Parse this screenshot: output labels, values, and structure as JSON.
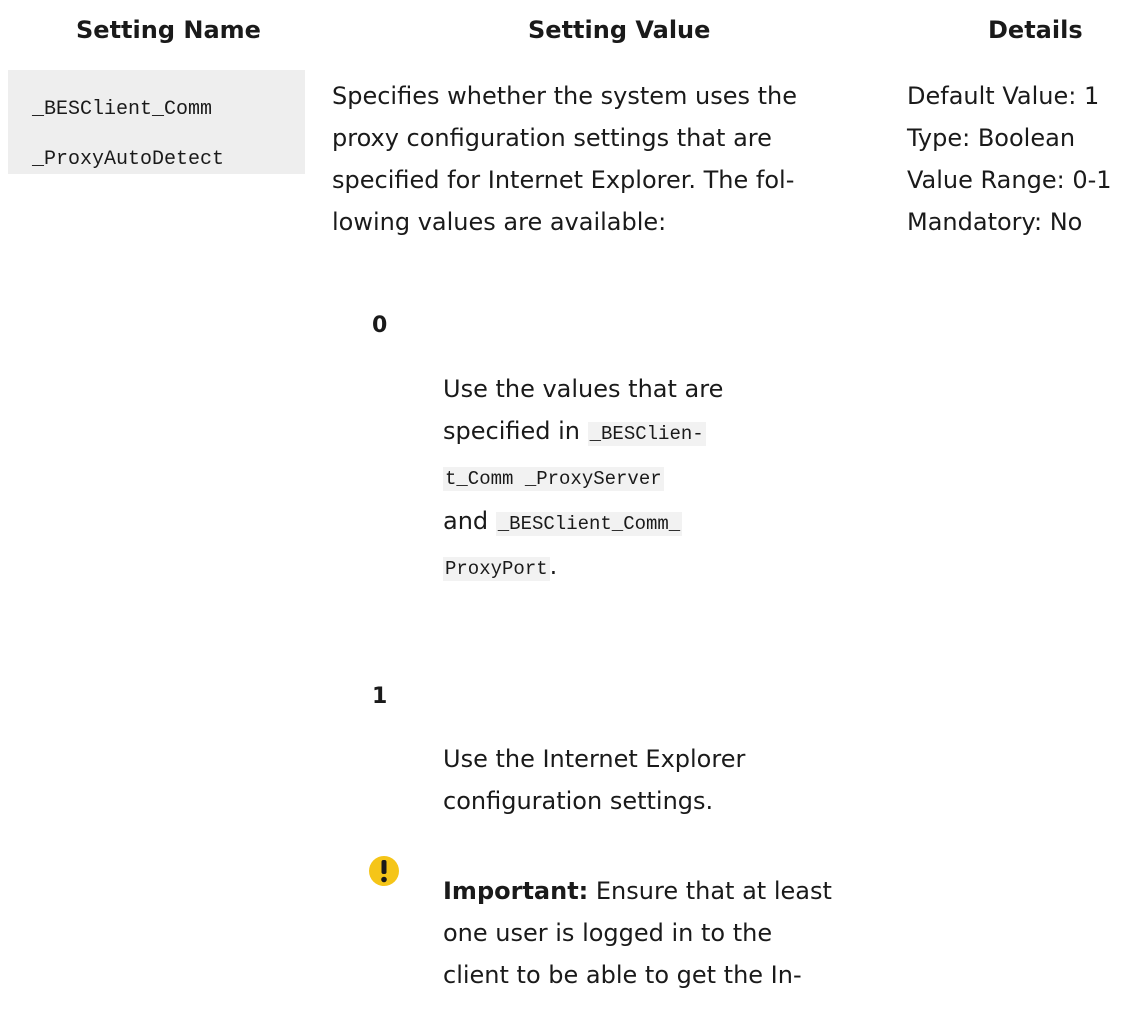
{
  "headers": {
    "name": "Setting Name",
    "value": "Setting Value",
    "details": "Details"
  },
  "setting_name": {
    "line1": "_BESClient_Comm",
    "line2": "_ProxyAutoDetect"
  },
  "setting_value": {
    "intro_lines": [
      "Specifies whether the system uses the",
      "proxy configuration settings that are",
      "specified for Internet Explorer. The fol-",
      "lowing values are available:"
    ],
    "options": [
      {
        "term": "0",
        "line1": "Use the values that are",
        "line2_text": "specified in ",
        "line2_code": "_BESClien-",
        "line3_code": "t_Comm _ProxyServer",
        "line4_text": "and ",
        "line4_code": "_BESClient_Comm_",
        "line5_code": "ProxyPort",
        "line5_text": "."
      },
      {
        "term": "1",
        "line1": "Use the Internet Explorer",
        "line2": "configuration settings."
      }
    ],
    "note": {
      "icon": "important-icon",
      "icon_color": "#f5c518",
      "label": "Important:",
      "line1_rest": " Ensure that at least",
      "line2": "one user is logged in to the",
      "line3": "client to be able to get the In-"
    }
  },
  "details": [
    "Default Value: 1",
    "Type: Boolean",
    "Value Range: 0-1",
    "Mandatory: No"
  ]
}
